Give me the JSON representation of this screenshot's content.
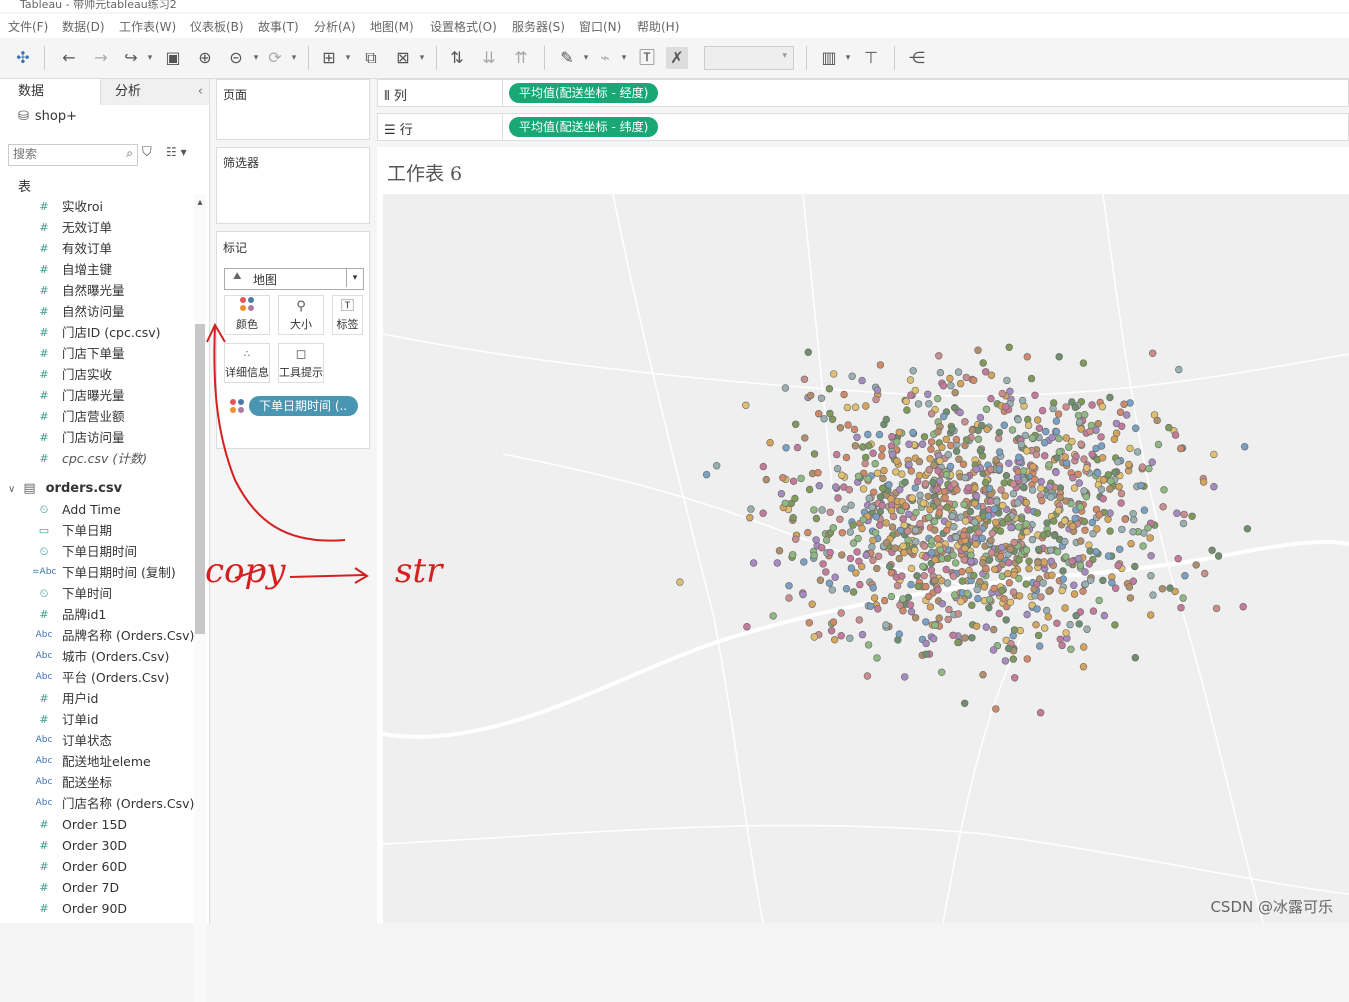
{
  "window": {
    "title": "Tableau - 带帅元tableau练习2"
  },
  "menu": [
    "文件(F)",
    "数据(D)",
    "工作表(W)",
    "仪表板(B)",
    "故事(T)",
    "分析(A)",
    "地图(M)",
    "设置格式(O)",
    "服务器(S)",
    "窗口(N)",
    "帮助(H)"
  ],
  "data_pane": {
    "tabs": {
      "data": "数据",
      "analysis": "分析"
    },
    "datasource": "shop+",
    "search_placeholder": "搜索",
    "section_label": "表",
    "fields_top": [
      {
        "icon": "#",
        "label": "实收roi"
      },
      {
        "icon": "#",
        "label": "无效订单"
      },
      {
        "icon": "#",
        "label": "有效订单"
      },
      {
        "icon": "#",
        "label": "自增主键"
      },
      {
        "icon": "#",
        "label": "自然曝光量"
      },
      {
        "icon": "#",
        "label": "自然访问量"
      },
      {
        "icon": "#",
        "label": "门店ID (cpc.csv)"
      },
      {
        "icon": "#",
        "label": "门店下单量"
      },
      {
        "icon": "#",
        "label": "门店实收"
      },
      {
        "icon": "#",
        "label": "门店曝光量"
      },
      {
        "icon": "#",
        "label": "门店营业额"
      },
      {
        "icon": "#",
        "label": "门店访问量"
      },
      {
        "icon": "#",
        "label": "cpc.csv (计数)"
      }
    ],
    "orders_table": "orders.csv",
    "fields_orders": [
      {
        "icon": "⏲",
        "label": "Add Time"
      },
      {
        "icon": "▭",
        "label": "下单日期"
      },
      {
        "icon": "⏲",
        "label": "下单日期时间"
      },
      {
        "icon": "=Abc",
        "label": "下单日期时间 (复制)"
      },
      {
        "icon": "⏲",
        "label": "下单时间"
      },
      {
        "icon": "#",
        "label": "品牌id1"
      },
      {
        "icon": "Abc",
        "label": "品牌名称 (Orders.Csv)"
      },
      {
        "icon": "Abc",
        "label": "城市 (Orders.Csv)"
      },
      {
        "icon": "Abc",
        "label": "平台 (Orders.Csv)"
      },
      {
        "icon": "#",
        "label": "用户id"
      },
      {
        "icon": "#",
        "label": "订单id"
      },
      {
        "icon": "Abc",
        "label": "订单状态"
      },
      {
        "icon": "Abc",
        "label": "配送地址eleme"
      },
      {
        "icon": "Abc",
        "label": "配送坐标"
      },
      {
        "icon": "Abc",
        "label": "门店名称 (Orders.Csv)"
      },
      {
        "icon": "#",
        "label": "Order 15D"
      },
      {
        "icon": "#",
        "label": "Order 30D"
      },
      {
        "icon": "#",
        "label": "Order 60D"
      },
      {
        "icon": "#",
        "label": "Order 7D"
      },
      {
        "icon": "#",
        "label": "Order 90D"
      }
    ]
  },
  "cards": {
    "pages": "页面",
    "filters": "筛选器",
    "marks": "标记",
    "marks_type": "地图",
    "mark_buttons": {
      "color": "颜色",
      "size": "大小",
      "label": "标签",
      "detail": "详细信息",
      "tooltip": "工具提示"
    },
    "color_pill": "下单日期时间 (.."
  },
  "shelves": {
    "columns_label": "列",
    "columns_pill": "平均值(配送坐标 - 经度)",
    "rows_label": "行",
    "rows_pill": "平均值(配送坐标 - 纬度)"
  },
  "view": {
    "title": "工作表 6"
  },
  "annotations": {
    "left": "copy",
    "right": "str"
  },
  "watermark": "CSDN @冰露可乐",
  "colors": {
    "pill_green": "#1aa776",
    "pill_blue": "#4996b2",
    "annotation_red": "#d42020"
  }
}
